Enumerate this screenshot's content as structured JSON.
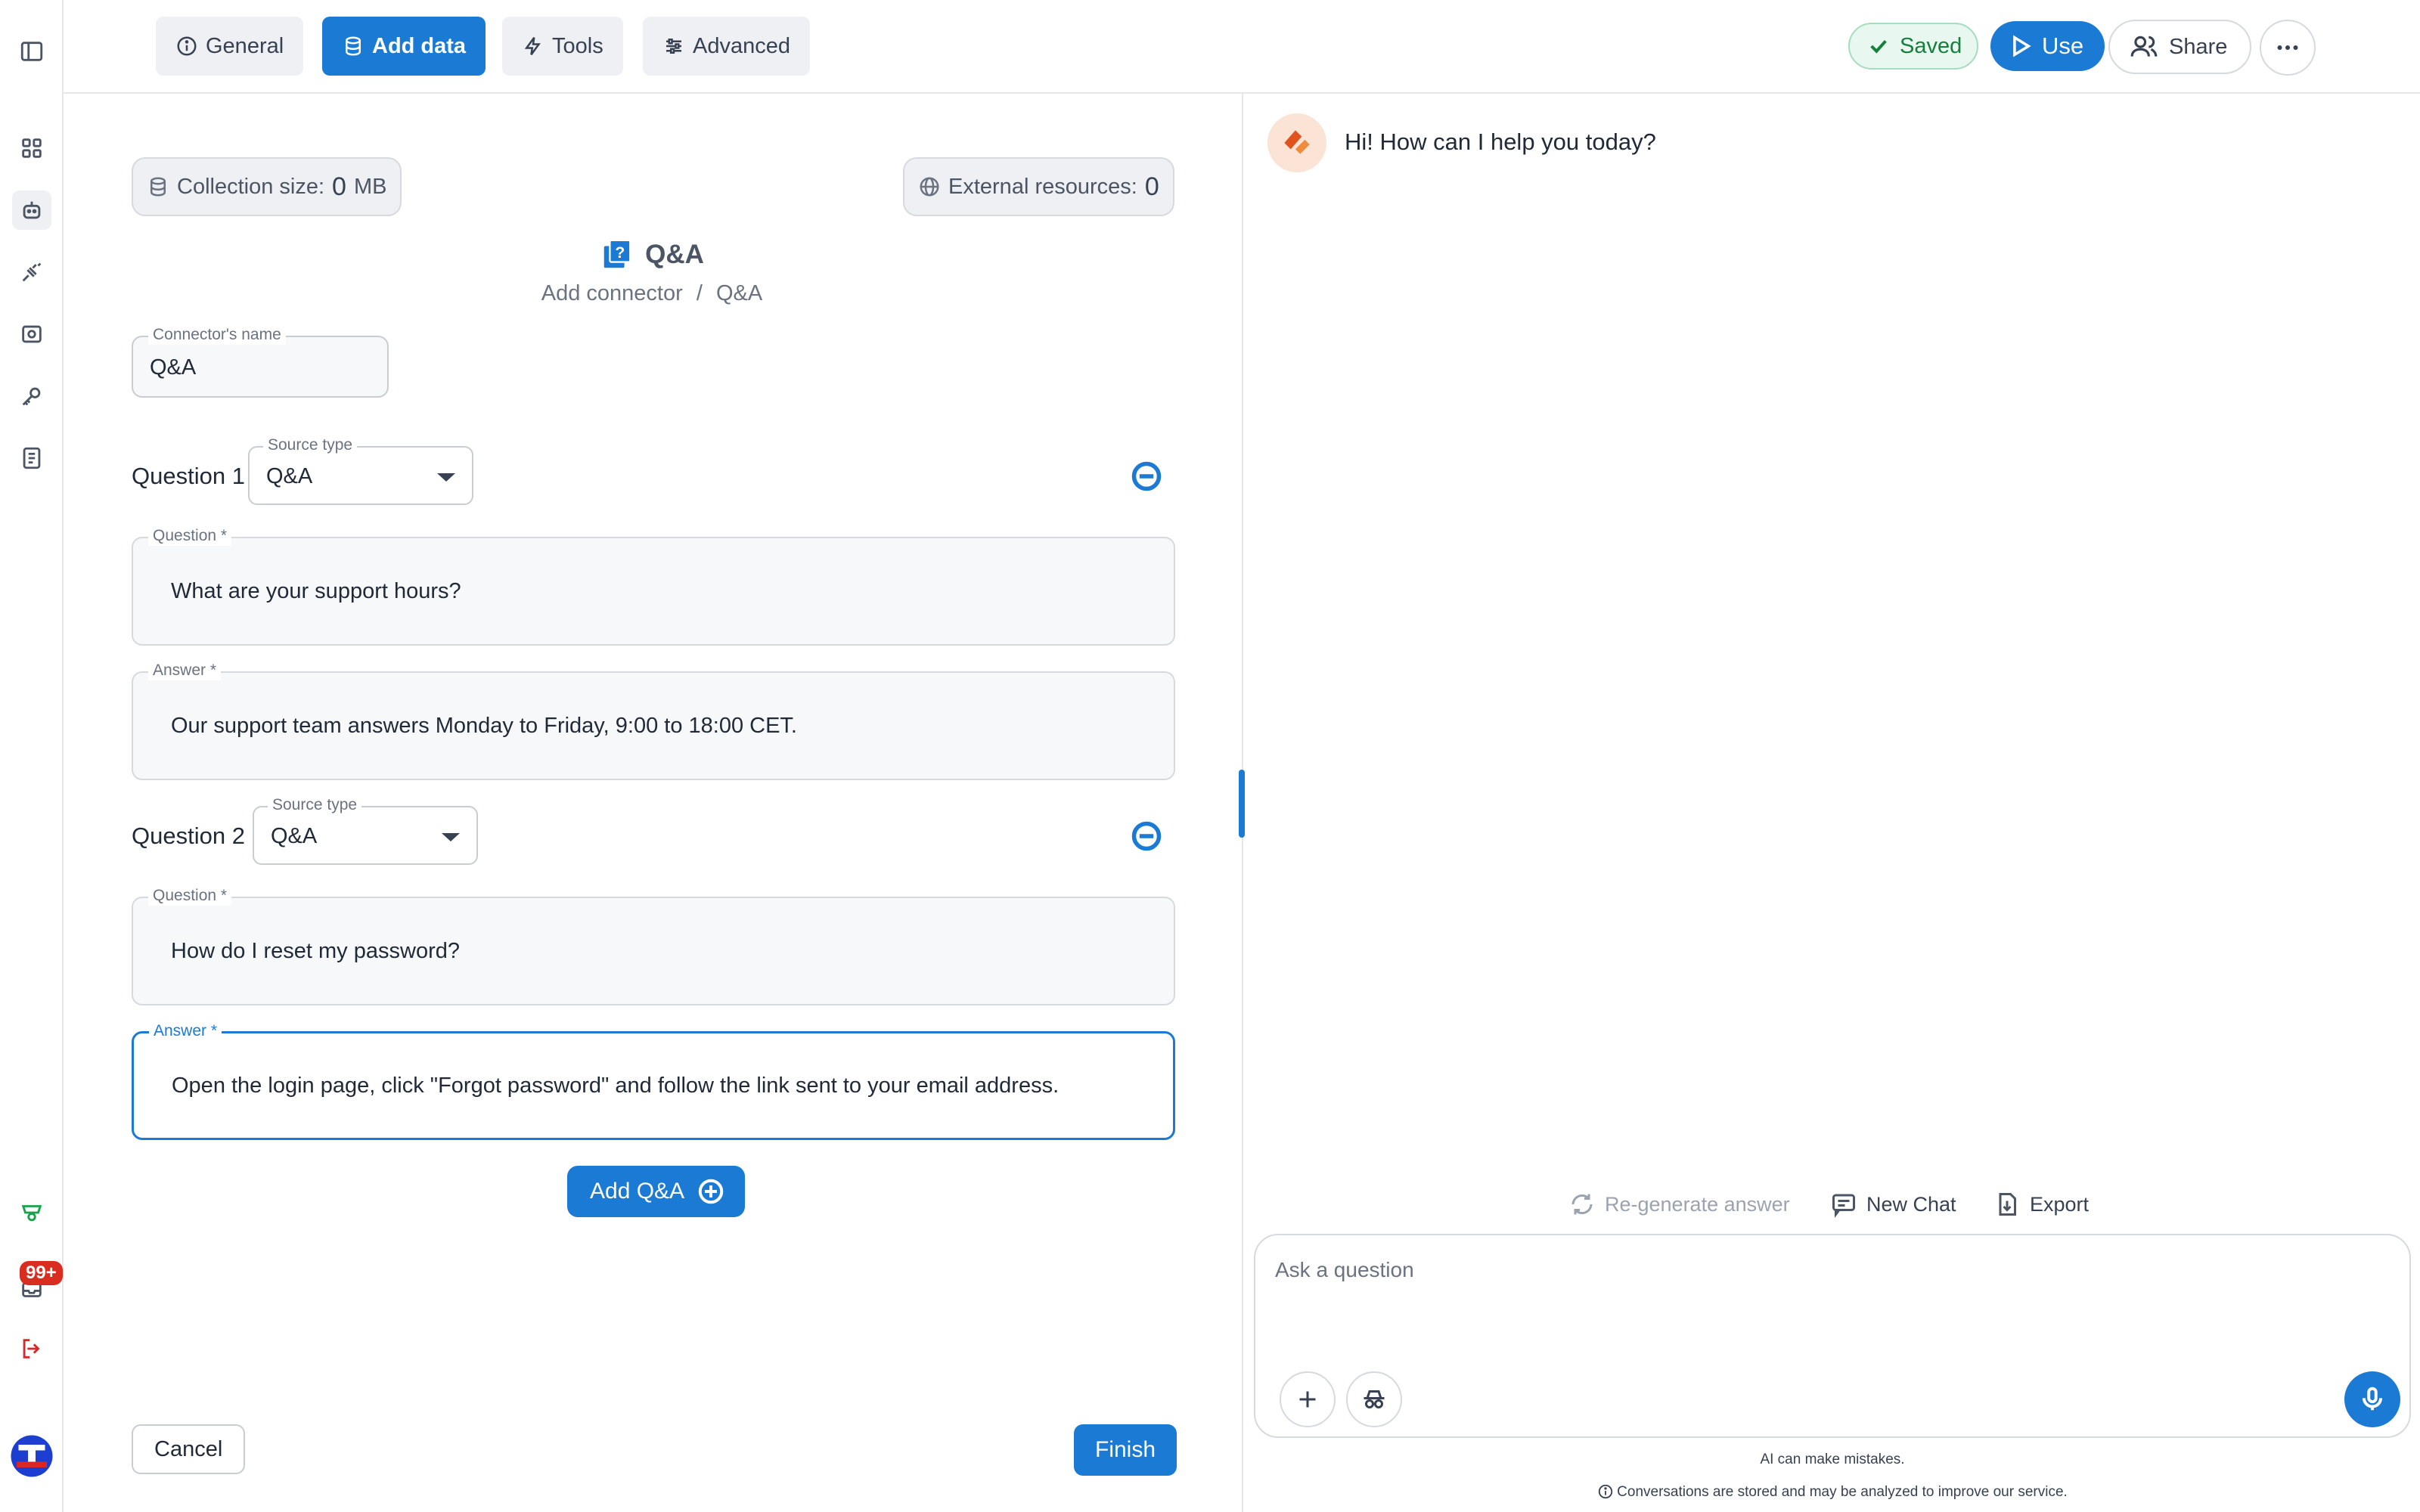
{
  "colors": {
    "accent": "#1a7ad4",
    "saved_green": "#15803d",
    "badge_red": "#d92d20"
  },
  "rail": {
    "icons": [
      "sidebar-toggle-icon",
      "grid-icon",
      "bot-icon",
      "plug-icon",
      "scan-icon",
      "key-icon",
      "notebook-icon",
      "team-icon",
      "inbox-icon",
      "logout-icon",
      "brand-logo"
    ],
    "badge": "99+"
  },
  "tabs": [
    {
      "label": "General",
      "icon": "info-icon"
    },
    {
      "label": "Add data",
      "icon": "database-icon"
    },
    {
      "label": "Tools",
      "icon": "lightning-icon"
    },
    {
      "label": "Advanced",
      "icon": "sliders-icon"
    }
  ],
  "header": {
    "saved": "Saved",
    "use": "Use",
    "share": "Share"
  },
  "stats": {
    "collection_label": "Collection size:",
    "collection_value": "0",
    "collection_unit": "MB",
    "external_label": "External resources:",
    "external_value": "0"
  },
  "connector": {
    "title": "Q&A",
    "crumb_parent": "Add connector",
    "crumb_sep": "/",
    "crumb_current": "Q&A",
    "name_label": "Connector's name",
    "name_value": "Q&A"
  },
  "questions": [
    {
      "label": "Question 1",
      "source_label": "Source type",
      "source_value": "Q&A",
      "question_label": "Question *",
      "question_value": "What are your support hours?",
      "answer_label": "Answer *",
      "answer_value": "Our support team answers Monday to Friday, 9:00 to 18:00 CET."
    },
    {
      "label": "Question 2",
      "source_label": "Source type",
      "source_value": "Q&A",
      "question_label": "Question *",
      "question_value": "How do I reset my password?",
      "answer_label": "Answer *",
      "answer_value": "Open the login page, click \"Forgot password\" and follow the link sent to your email address."
    }
  ],
  "actions": {
    "add_qa": "Add Q&A",
    "cancel": "Cancel",
    "finish": "Finish"
  },
  "chat": {
    "greeting": "Hi! How can I help you today?",
    "regenerate": "Re-generate answer",
    "new_chat": "New Chat",
    "export": "Export",
    "placeholder": "Ask a question",
    "disclaimer_1": "AI can make mistakes.",
    "disclaimer_2": "Conversations are stored and may be analyzed to improve our service."
  }
}
